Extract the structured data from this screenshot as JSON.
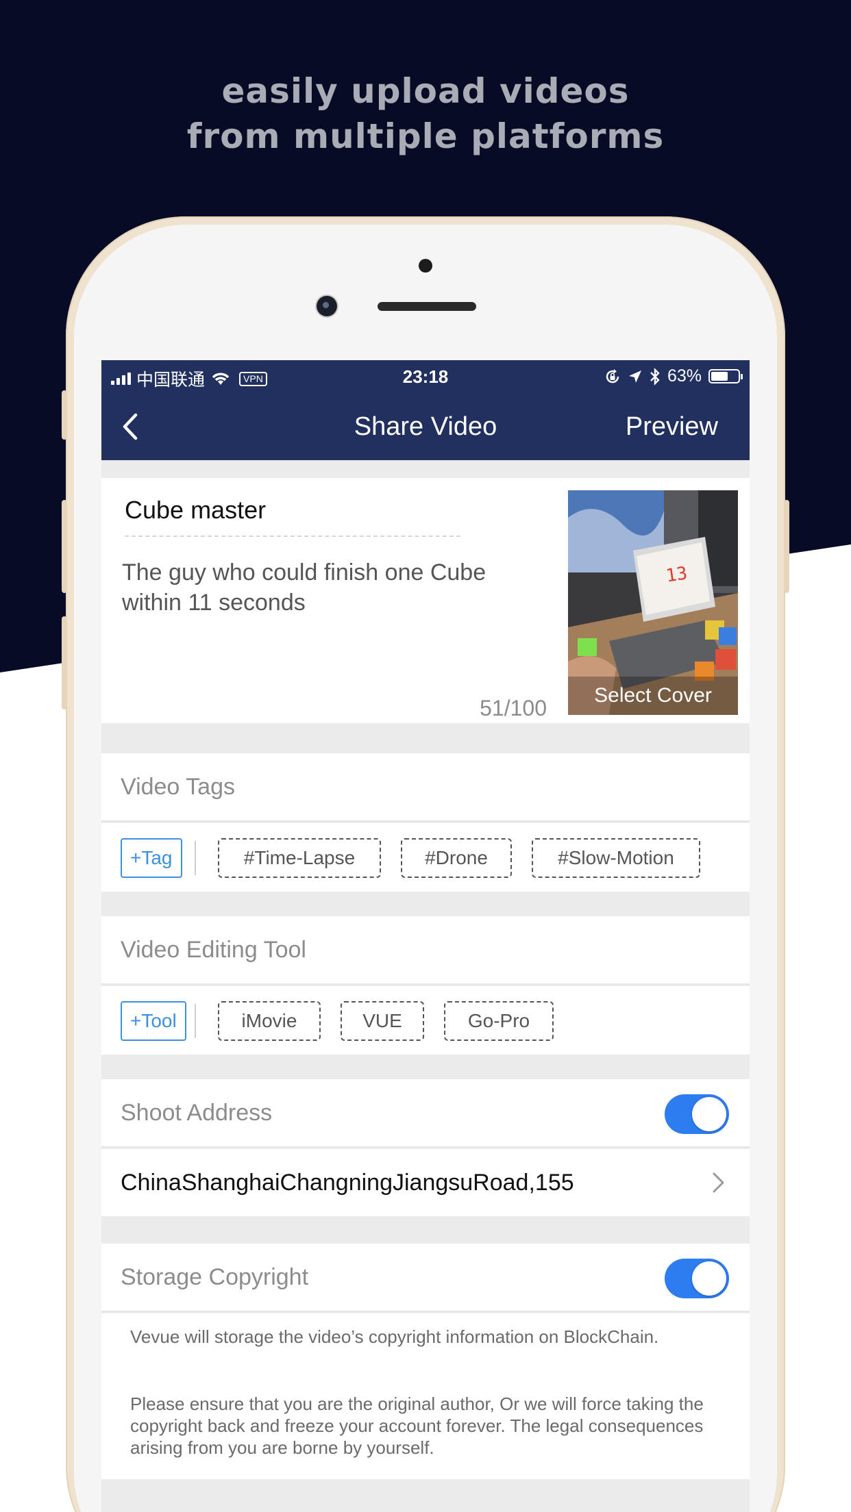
{
  "promo": {
    "line1": "easily upload videos",
    "line2": "from multiple platforms"
  },
  "colors": {
    "background_dark": "#070b26",
    "nav_bar": "#22305f",
    "accent_blue": "#3d8fe0",
    "toggle_on": "#2d7cf0",
    "phone_gold": "#efe3cf"
  },
  "status_bar": {
    "carrier": "中国联通",
    "vpn": "VPN",
    "time": "23:18",
    "battery": "63%",
    "battery_level": 0.63,
    "icons": [
      "signal-icon",
      "wifi-icon",
      "rotation-lock-icon",
      "location-arrow-icon",
      "bluetooth-icon",
      "battery-icon"
    ]
  },
  "nav": {
    "back_icon": "chevron-left-icon",
    "title": "Share Video",
    "preview": "Preview"
  },
  "video": {
    "title": "Cube master",
    "description": "The guy who could finish one Cube within 11 seconds",
    "char_count": "51/100",
    "cover_label": "Select Cover",
    "cover_screen_number": "13"
  },
  "tags": {
    "header": "Video Tags",
    "add_label": "+Tag",
    "items": [
      "#Time-Lapse",
      "#Drone",
      "#Slow-Motion"
    ]
  },
  "tools": {
    "header": "Video Editing Tool",
    "add_label": "+Tool",
    "items": [
      "iMovie",
      "VUE",
      "Go-Pro"
    ]
  },
  "shoot_address": {
    "header": "Shoot Address",
    "enabled": true,
    "address": "ChinaShanghaiChangningJiangsuRoad,155"
  },
  "storage_copyright": {
    "header": "Storage Copyright",
    "enabled": true,
    "note1": "Vevue will storage the video’s copyright information on BlockChain.",
    "note2": "Please ensure that you are the original author, Or we will force taking the copyright back and freeze your account forever. The legal consequences arising from you are borne by yourself."
  }
}
